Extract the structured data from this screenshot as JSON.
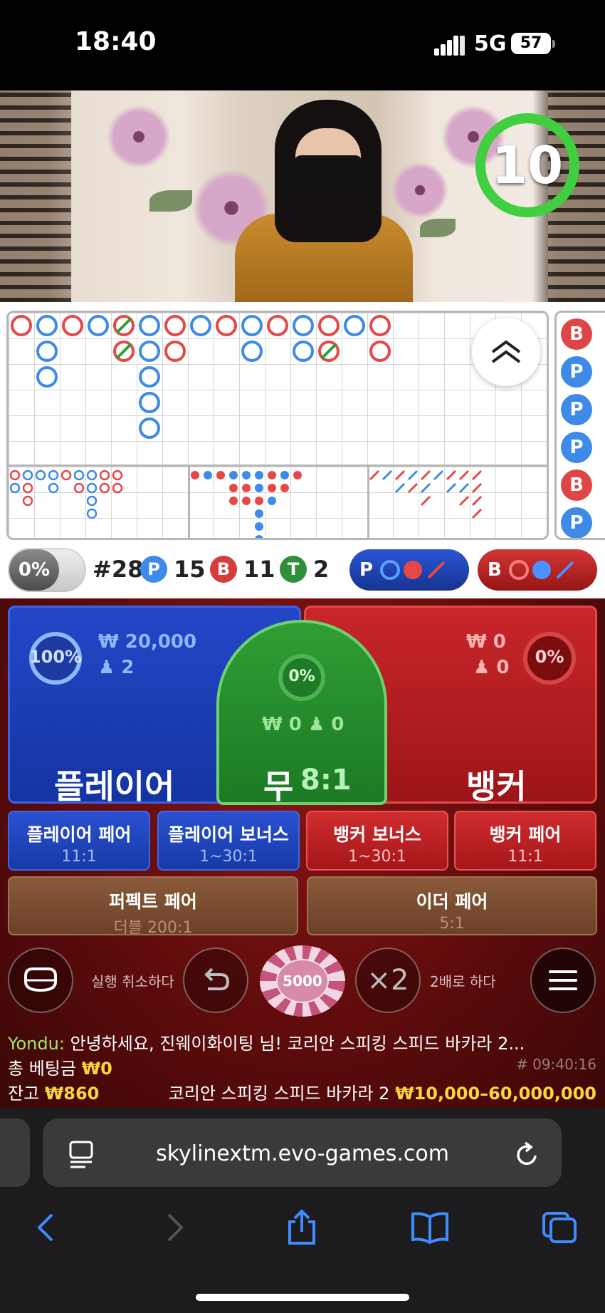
{
  "status": {
    "time": "18:40",
    "network": "5G",
    "battery": "57"
  },
  "video": {
    "countdown": "10"
  },
  "stats": {
    "pct_toggle": "0%",
    "round": "#28",
    "player_letter": "P",
    "player_count": "15",
    "banker_letter": "B",
    "banker_count": "11",
    "tie_letter": "T",
    "tie_count": "2",
    "player_predict": "P",
    "banker_predict": "B"
  },
  "side_road": [
    "B",
    "P",
    "P",
    "P",
    "B",
    "P"
  ],
  "bets": {
    "player": {
      "label": "플레이어",
      "percent": "100%",
      "amount": "₩ 20,000",
      "players": "2"
    },
    "tie": {
      "label": "무",
      "odds": "8:1",
      "percent": "0%",
      "amount": "₩ 0",
      "players": "0"
    },
    "banker": {
      "label": "뱅커",
      "percent": "0%",
      "amount": "₩ 0",
      "players": "0"
    },
    "player_pair": {
      "label": "플레이어 페어",
      "odds": "11:1"
    },
    "player_bonus": {
      "label": "플레이어 보너스",
      "odds": "1~30:1"
    },
    "banker_bonus": {
      "label": "뱅커 보너스",
      "odds": "1~30:1"
    },
    "banker_pair": {
      "label": "뱅커 페어",
      "odds": "11:1"
    },
    "perfect_pair": {
      "label": "퍼펙트 페어",
      "odds": "더블 200:1"
    },
    "either_pair": {
      "label": "이더 페어",
      "odds": "5:1"
    }
  },
  "controls": {
    "undo_label": "실행 취소하다",
    "chip_value": "5000",
    "double_symbol": "×2",
    "double_label": "2배로 하다"
  },
  "chat": {
    "user": "Yondu:",
    "message": "안녕하세요, 진웨이화이팅 님! 코리안 스피킹 스피드 바카라 2..."
  },
  "footer": {
    "total_bet_label": "총 베팅금",
    "total_bet": "₩0",
    "timestamp": "# 09:40:16",
    "balance_label": "잔고",
    "balance": "₩860",
    "table_name": "코리안 스피킹 스피드 바카라 2",
    "limits": "₩10,000–60,000,000"
  },
  "browser": {
    "url": "skylinextm.evo-games.com"
  },
  "colors": {
    "player": "#2347c8",
    "banker": "#c8262a",
    "tie": "#2f9e34",
    "timer": "#3fcf3f",
    "chip": "#c5547a"
  }
}
